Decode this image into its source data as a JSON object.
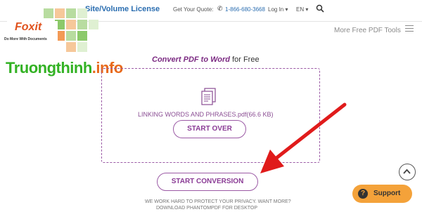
{
  "top_nav": {
    "license_link": "Site/Volume License",
    "quote_label": "Get Your Quote:",
    "phone": "1-866-680-3668",
    "login": "Log In ▾",
    "language": "EN ▾"
  },
  "logo": {
    "brand": "Foxit",
    "tagline": "Do More With Documents"
  },
  "watermark": {
    "name": "Truongthinh",
    "tld": ".info"
  },
  "tools_menu": {
    "label": "More Free PDF Tools"
  },
  "converter": {
    "headline_strong": "Convert PDF to Word",
    "headline_rest": " for Free",
    "file_name": "LINKING WORDS AND PHRASES.pdf(66.6 KB)",
    "start_over": "START OVER",
    "start_conversion": "START CONVERSION",
    "privacy_line1": "WE WORK HARD TO PROTECT YOUR PRIVACY. WANT MORE?",
    "privacy_line2": "DOWNLOAD PHANTOMPDF FOR DESKTOP"
  },
  "support": {
    "label": "Support"
  },
  "colors": {
    "accent": "#9b5aa5",
    "brand_orange": "#e0531f",
    "link_blue": "#2a6db0",
    "support": "#f4a23a",
    "arrow": "#e01b1b"
  }
}
